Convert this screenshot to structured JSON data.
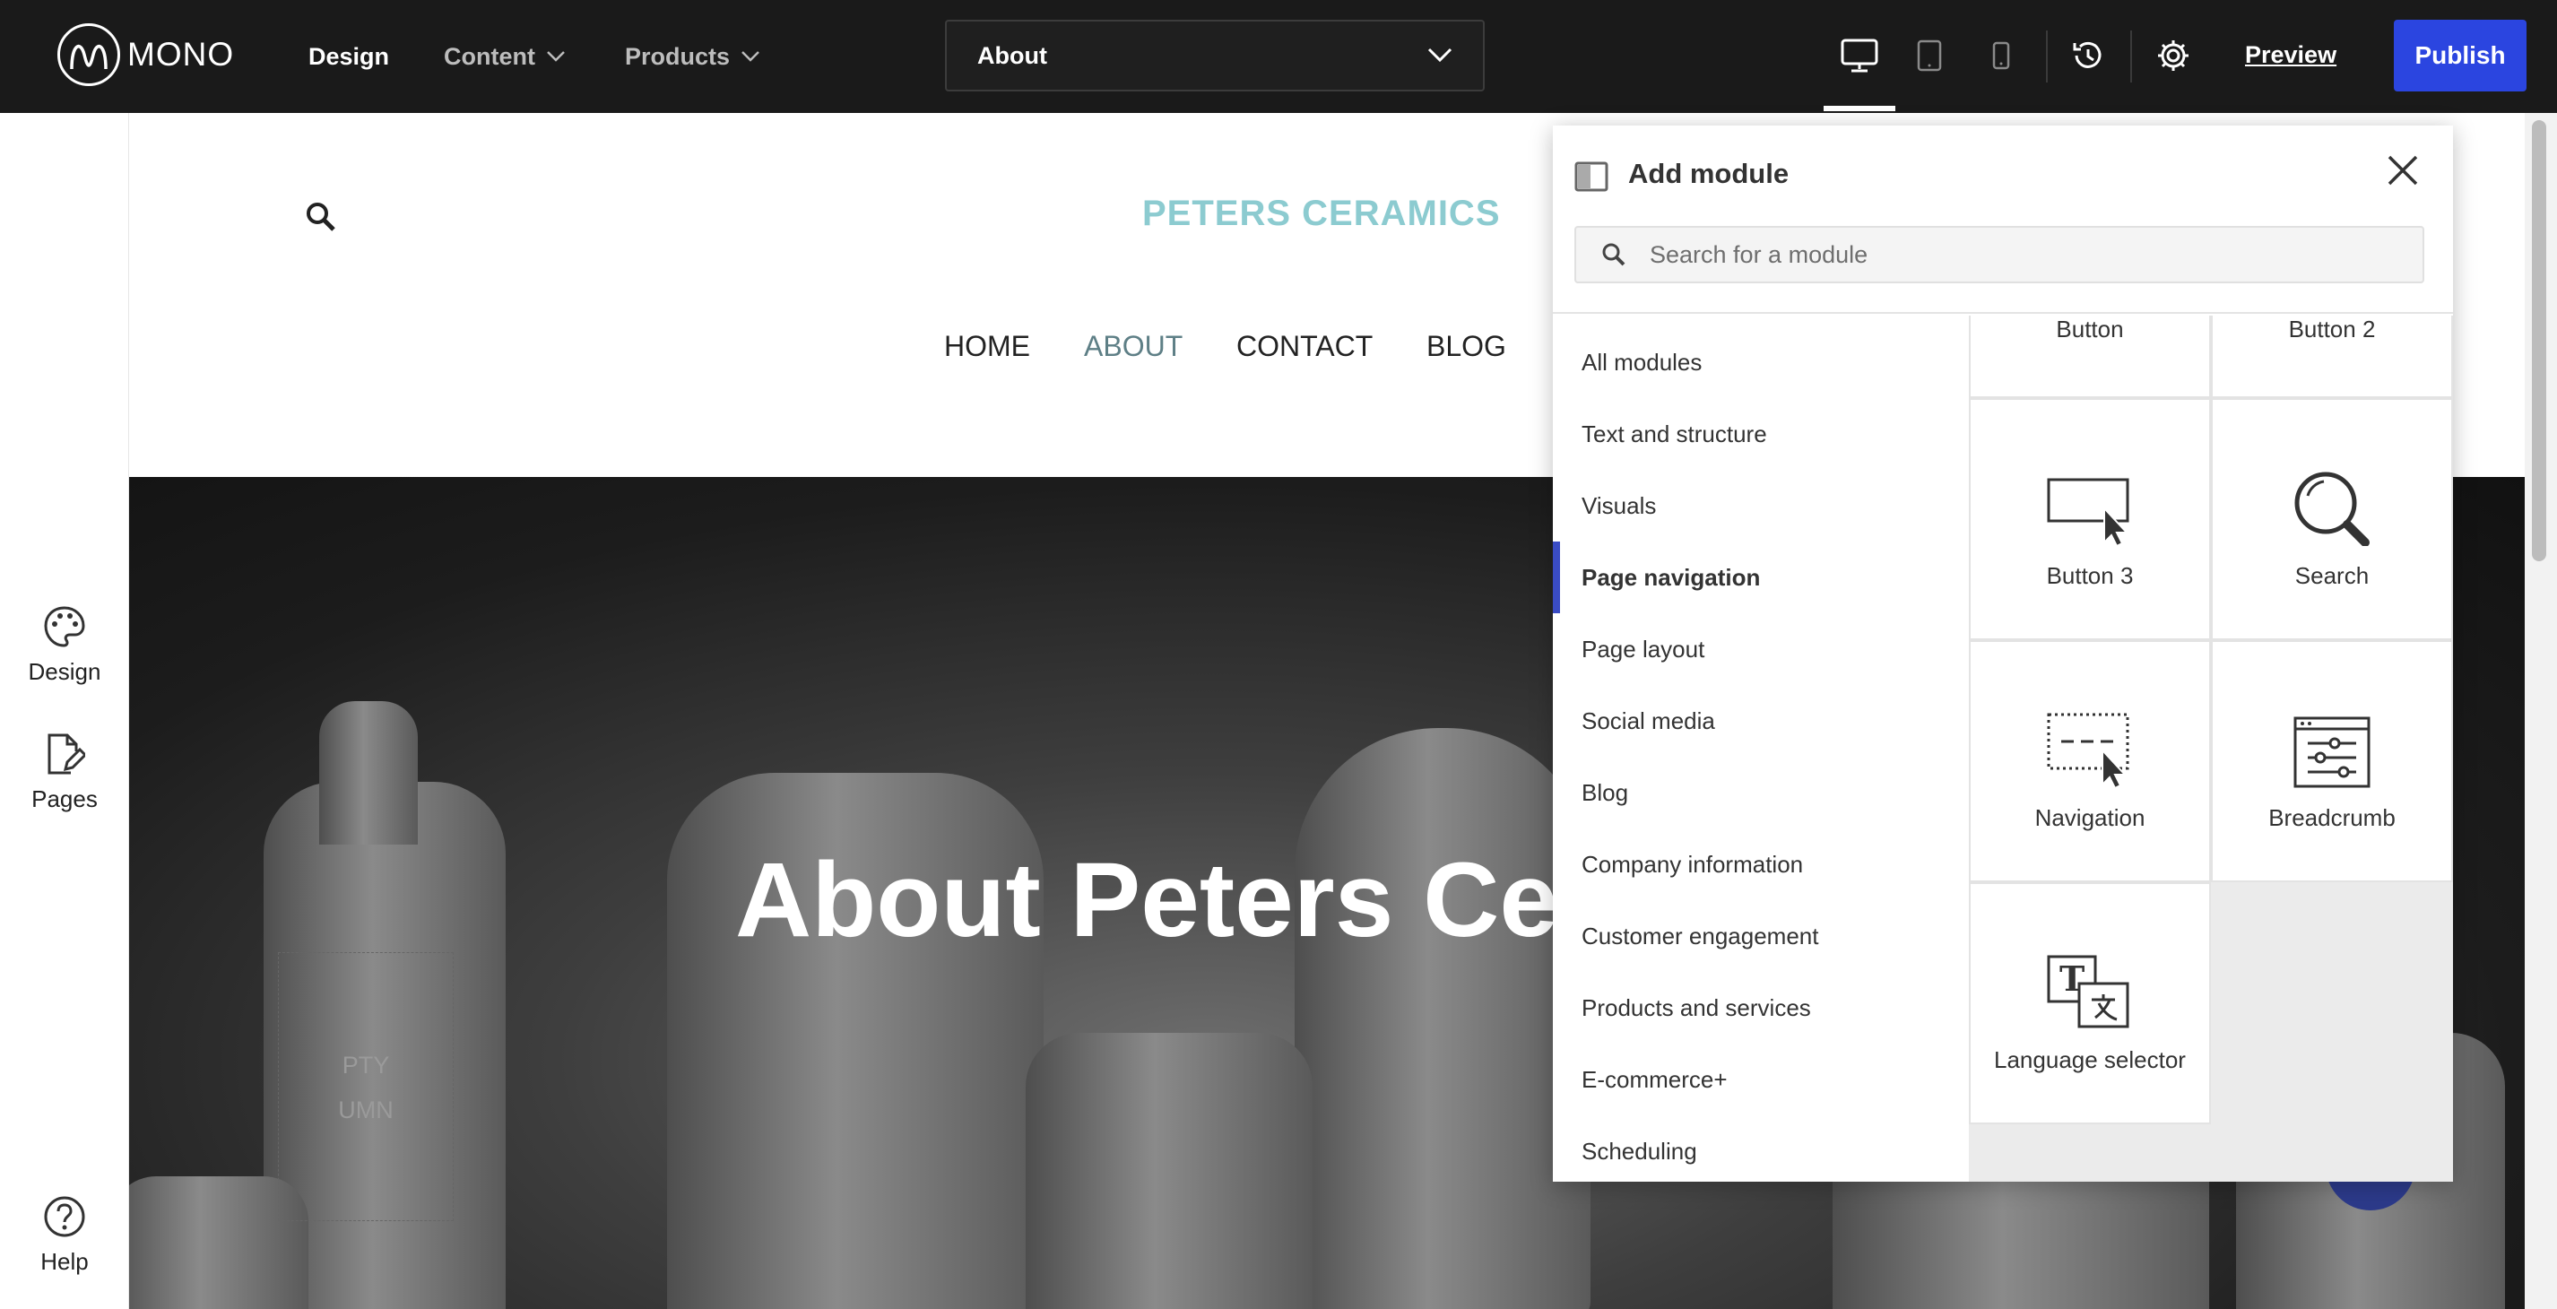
{
  "topbar": {
    "logo_text": "MONO",
    "nav": {
      "design": "Design",
      "content": "Content",
      "products": "Products"
    },
    "page_selector_value": "About",
    "preview_label": "Preview",
    "publish_label": "Publish"
  },
  "sidebar": {
    "design": "Design",
    "pages": "Pages",
    "help": "Help"
  },
  "site": {
    "brand": "PETERS CERAMICS",
    "nav": [
      "HOME",
      "ABOUT",
      "CONTACT",
      "BLOG"
    ],
    "hero_title": "About Peters Ce",
    "empty_column_line1": "PTY",
    "empty_column_line2": "UMN"
  },
  "panel": {
    "title": "Add module",
    "search_placeholder": "Search for a module",
    "categories": [
      "All modules",
      "Text and structure",
      "Visuals",
      "Page navigation",
      "Page layout",
      "Social media",
      "Blog",
      "Company information",
      "Customer engagement",
      "Products and services",
      "E-commerce+",
      "Scheduling"
    ],
    "active_category": "Page navigation",
    "modules": [
      "Button",
      "Button 2",
      "Button 3",
      "Search",
      "Navigation",
      "Breadcrumb",
      "Language selector"
    ]
  },
  "colors": {
    "topbar_bg": "#1a1a1a",
    "publish": "#2b45e0",
    "brand": "#8ccbd0",
    "active_nav": "#5e7f86",
    "active_category_bar": "#3a4cc4"
  }
}
